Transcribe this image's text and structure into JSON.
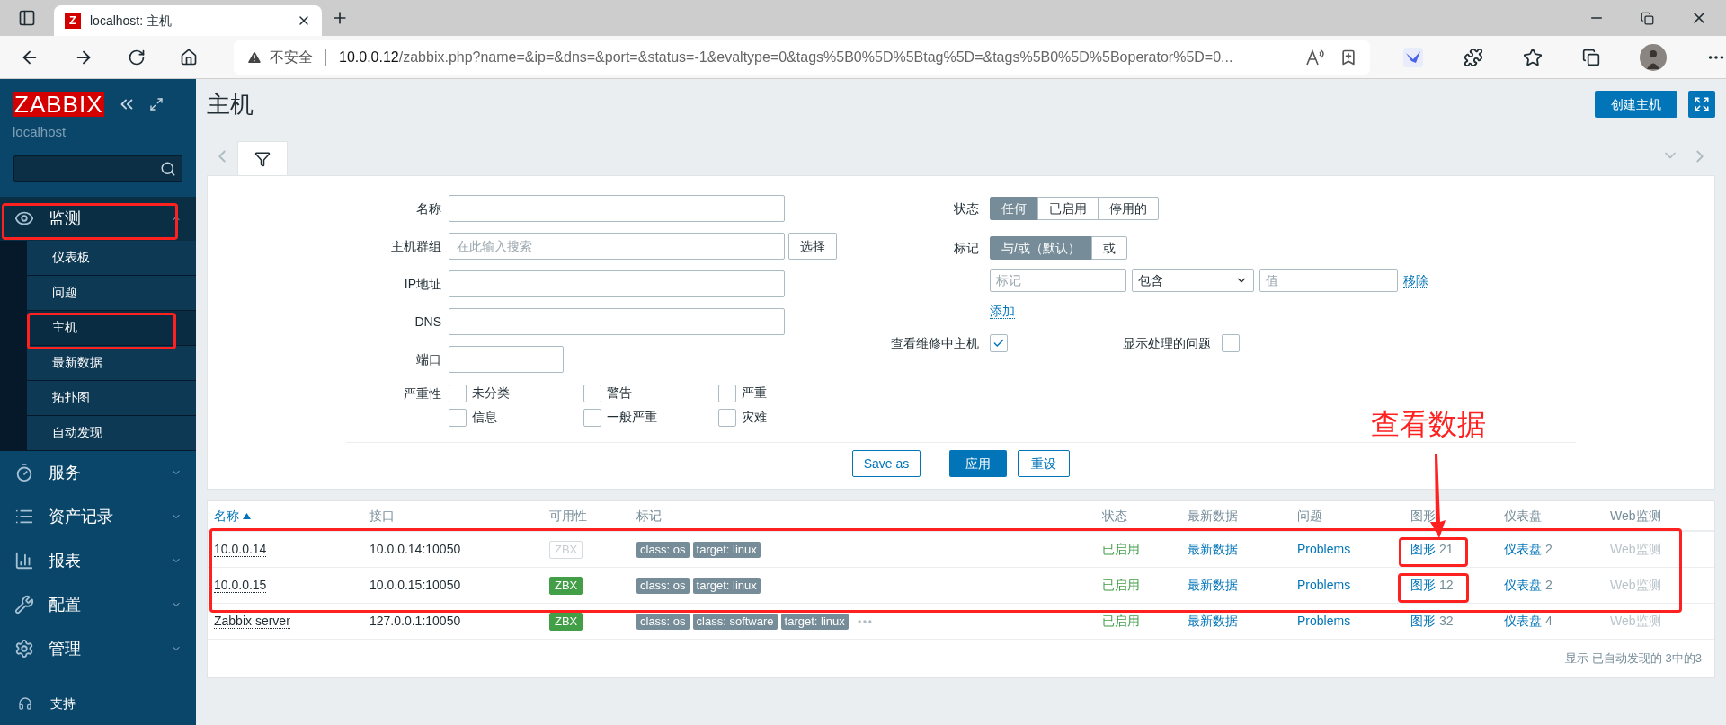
{
  "browser": {
    "tabs": [
      {
        "favicon": "Z",
        "title": "localhost: 主机",
        "selected": true
      }
    ],
    "address": {
      "security": "不安全",
      "host": "10.0.0.12",
      "path": "/zabbix.php?name=&ip=&dns=&port=&status=-1&evaltype=0&tags%5B0%5D%5Btag%5D=&tags%5B0%5D%5Boperator%5D=0..."
    }
  },
  "sidebar": {
    "logo": "ZABBIX",
    "server": "localhost",
    "menu": [
      {
        "label": "监测",
        "expanded": true,
        "children": [
          {
            "label": "仪表板",
            "selected": false
          },
          {
            "label": "问题",
            "selected": false
          },
          {
            "label": "主机",
            "selected": true
          },
          {
            "label": "最新数据",
            "selected": false
          },
          {
            "label": "拓扑图",
            "selected": false
          },
          {
            "label": "自动发现",
            "selected": false
          }
        ]
      },
      {
        "label": "服务",
        "expanded": false
      },
      {
        "label": "资产记录",
        "expanded": false
      },
      {
        "label": "报表",
        "expanded": false
      },
      {
        "label": "配置",
        "expanded": false
      },
      {
        "label": "管理",
        "expanded": false
      }
    ],
    "support": "支持"
  },
  "header": {
    "title": "主机",
    "create_button": "创建主机"
  },
  "filter": {
    "left": [
      {
        "label": "名称",
        "kind": "input"
      },
      {
        "label": "主机群组",
        "kind": "input-button",
        "placeholder": "在此输入搜索",
        "button": "选择"
      },
      {
        "label": "IP地址",
        "kind": "input"
      },
      {
        "label": "DNS",
        "kind": "input"
      },
      {
        "label": "端口",
        "kind": "short"
      }
    ],
    "severity": {
      "label": "严重性",
      "options": [
        {
          "label": "未分类",
          "checked": false
        },
        {
          "label": "警告",
          "checked": false
        },
        {
          "label": "严重",
          "checked": false
        },
        {
          "label": "信息",
          "checked": false
        },
        {
          "label": "一般严重",
          "checked": false
        },
        {
          "label": "灾难",
          "checked": false
        }
      ]
    },
    "status": {
      "label": "状态",
      "options": [
        {
          "label": "任何",
          "selected": true
        },
        {
          "label": "已启用",
          "selected": false
        },
        {
          "label": "停用的",
          "selected": false
        }
      ]
    },
    "tags": {
      "label": "标记",
      "options": [
        {
          "label": "与/或（默认）",
          "selected": true
        },
        {
          "label": "或",
          "selected": false
        }
      ],
      "tag_placeholder": "标记",
      "operator": "包含",
      "value_placeholder": "值",
      "remove": "移除",
      "add": "添加"
    },
    "maintenance": {
      "label": "查看维修中主机",
      "checked": true
    },
    "suppressed": {
      "label": "显示处理的问题",
      "checked": false
    },
    "buttons": {
      "save_as": "Save as",
      "apply": "应用",
      "reset": "重设"
    }
  },
  "table": {
    "columns": [
      {
        "label": "名称",
        "sorted": true
      },
      {
        "label": "接口",
        "sorted": false
      },
      {
        "label": "可用性",
        "sorted": false
      },
      {
        "label": "标记",
        "sorted": false
      },
      {
        "label": "状态",
        "sorted": false
      },
      {
        "label": "最新数据",
        "sorted": false
      },
      {
        "label": "问题",
        "sorted": false
      },
      {
        "label": "图形",
        "sorted": false
      },
      {
        "label": "仪表盘",
        "sorted": false
      },
      {
        "label": "Web监测",
        "sorted": false
      }
    ],
    "rows": [
      {
        "name": "10.0.0.14",
        "interface": "10.0.0.14:10050",
        "availability": {
          "label": "ZBX",
          "kind": "unknown"
        },
        "tags": [
          "class: os",
          "target: linux"
        ],
        "more_tags": false,
        "status": "已启用",
        "latest": "最新数据",
        "problems": "Problems",
        "graphs": {
          "label": "图形",
          "count": "21"
        },
        "dashboards": {
          "label": "仪表盘",
          "count": "2"
        },
        "web": "Web监测"
      },
      {
        "name": "10.0.0.15",
        "interface": "10.0.0.15:10050",
        "availability": {
          "label": "ZBX",
          "kind": "available"
        },
        "tags": [
          "class: os",
          "target: linux"
        ],
        "more_tags": false,
        "status": "已启用",
        "latest": "最新数据",
        "problems": "Problems",
        "graphs": {
          "label": "图形",
          "count": "12"
        },
        "dashboards": {
          "label": "仪表盘",
          "count": "2"
        },
        "web": "Web监测"
      },
      {
        "name": "Zabbix server",
        "interface": "127.0.0.1:10050",
        "availability": {
          "label": "ZBX",
          "kind": "available"
        },
        "tags": [
          "class: os",
          "class: software",
          "target: linux"
        ],
        "more_tags": true,
        "status": "已启用",
        "latest": "最新数据",
        "problems": "Problems",
        "graphs": {
          "label": "图形",
          "count": "32"
        },
        "dashboards": {
          "label": "仪表盘",
          "count": "4"
        },
        "web": "Web监测"
      }
    ],
    "footer": "显示 已自动发现的 3中的3"
  },
  "annotation": {
    "label": "查看数据"
  }
}
